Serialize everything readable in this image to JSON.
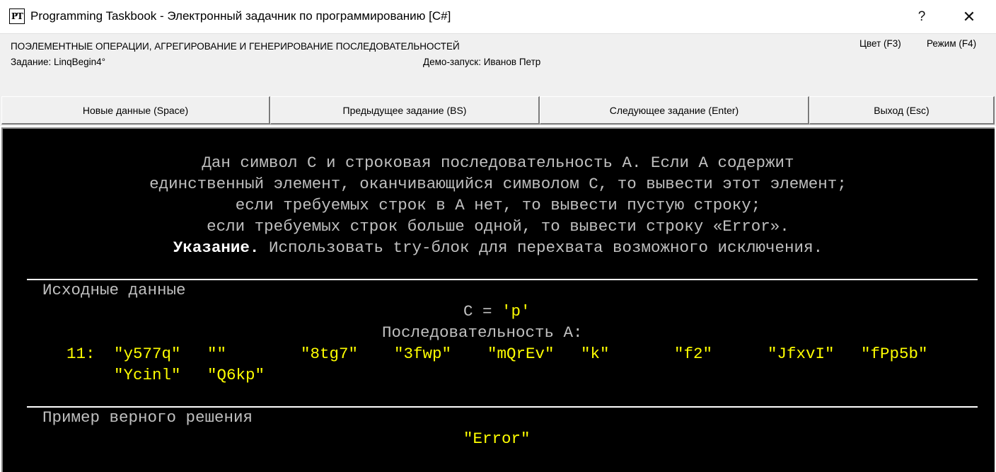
{
  "window": {
    "icon_text": "PT",
    "title": "Programming Taskbook - Электронный задачник по программированию [C#]",
    "help_glyph": "?",
    "close_glyph": "✕"
  },
  "header": {
    "section_title": "ПОЭЛЕМЕНТНЫЕ ОПЕРАЦИИ, АГРЕГИРОВАНИЕ И ГЕНЕРИРОВАНИЕ ПОСЛЕДОВАТЕЛЬНОСТЕЙ",
    "task": "Задание: LinqBegin4°",
    "demo": "Демо-запуск: Иванов Петр",
    "color_label": "Цвет (F3)",
    "mode_label": "Режим (F4)"
  },
  "buttons": {
    "new_data": "Новые данные (Space)",
    "prev_task": "Предыдущее задание (BS)",
    "next_task": "Следующее задание (Enter)",
    "exit": "Выход (Esc)"
  },
  "task_text": {
    "line1": "Дан символ C и строковая последовательность A. Если A содержит",
    "line2": "единственный элемент, оканчивающийся символом C, то вывести этот элемент;",
    "line3": "если требуемых строк в A нет, то вывести пустую строку;",
    "line4": "если требуемых строк больше одной, то вывести строку «Error».",
    "hint_bold": "Указание.",
    "hint_rest": " Использовать try-блок для перехвата возможного исключения."
  },
  "input_section": {
    "title": "Исходные данные",
    "c_label": "C = ",
    "c_value": "'p'",
    "seq_label": "Последовательность A:",
    "count": "11:",
    "items": [
      "\"y577q\"",
      "\"\"",
      "\"8tg7\"",
      "\"3fwp\"",
      "\"mQrEv\"",
      "\"k\"",
      "\"f2\"",
      "\"JfxvI\"",
      "\"fPp5b\"",
      "\"Ycinl\"",
      "\"Q6kp\""
    ]
  },
  "output_section": {
    "title": "Пример верного решения",
    "result": "\"Error\""
  },
  "colors": {
    "console_bg": "#000000",
    "text_gray": "#c0c0c0",
    "data_yellow": "#ffff00",
    "window_bg": "#f0f0f0"
  }
}
